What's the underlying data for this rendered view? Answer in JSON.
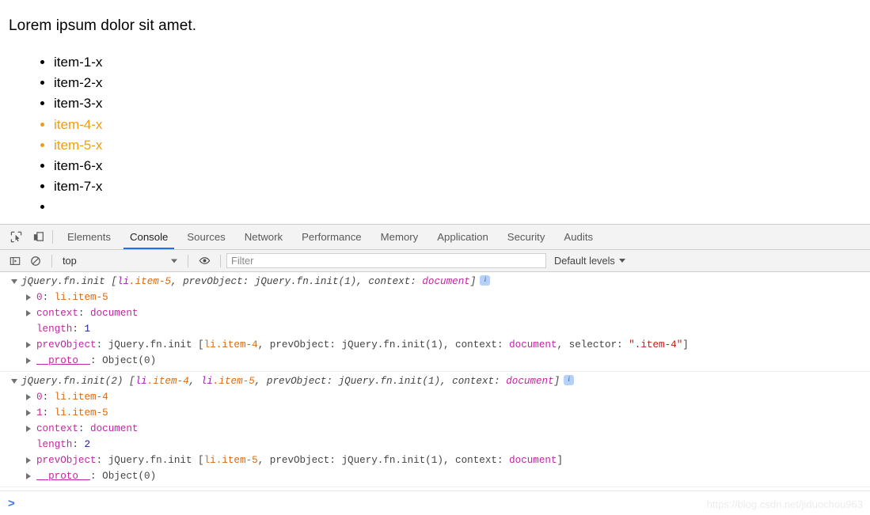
{
  "page": {
    "paragraph": "Lorem ipsum dolor sit amet.",
    "items": [
      {
        "label": "item-1-x",
        "highlighted": false
      },
      {
        "label": "item-2-x",
        "highlighted": false
      },
      {
        "label": "item-3-x",
        "highlighted": false
      },
      {
        "label": "item-4-x",
        "highlighted": true
      },
      {
        "label": "item-5-x",
        "highlighted": true
      },
      {
        "label": "item-6-x",
        "highlighted": false
      },
      {
        "label": "item-7-x",
        "highlighted": false
      },
      {
        "label": "",
        "highlighted": false
      }
    ],
    "highlight_color": "#f39c12"
  },
  "devtools": {
    "toolbar_icons": [
      {
        "name": "inspect-element-icon"
      },
      {
        "name": "device-toolbar-icon"
      }
    ],
    "tabs": [
      {
        "label": "Elements",
        "active": false
      },
      {
        "label": "Console",
        "active": true
      },
      {
        "label": "Sources",
        "active": false
      },
      {
        "label": "Network",
        "active": false
      },
      {
        "label": "Performance",
        "active": false
      },
      {
        "label": "Memory",
        "active": false
      },
      {
        "label": "Application",
        "active": false
      },
      {
        "label": "Security",
        "active": false
      },
      {
        "label": "Audits",
        "active": false
      }
    ],
    "active_tab_underline_color": "#1a73e8",
    "filterbar": {
      "sidebar_toggle_icon": "console-sidebar-icon",
      "clear_console_icon": "clear-console-icon",
      "context_value": "top",
      "eye_icon": "live-expression-icon",
      "filter_placeholder": "Filter",
      "filter_value": "",
      "levels_label": "Default levels"
    },
    "prompt_symbol": ">"
  },
  "console": {
    "messages": [
      {
        "header": [
          {
            "t": "jQuery.fn.init [",
            "c": "c-plain italic"
          },
          {
            "t": "li",
            "c": "c-tag italic"
          },
          {
            "t": ".item-5",
            "c": "c-class italic"
          },
          {
            "t": ", prevObject: jQuery.fn.init(1), context: ",
            "c": "c-plain italic"
          },
          {
            "t": "document",
            "c": "c-prop italic"
          },
          {
            "t": "]",
            "c": "c-plain italic"
          }
        ],
        "badge": "i",
        "rows": [
          {
            "expandable": true,
            "parts": [
              {
                "t": "0",
                "c": "c-prop"
              },
              {
                "t": ": ",
                "c": "c-plain"
              },
              {
                "t": "li.item-5",
                "c": "c-class"
              }
            ]
          },
          {
            "expandable": true,
            "parts": [
              {
                "t": "context",
                "c": "c-prop"
              },
              {
                "t": ": ",
                "c": "c-plain"
              },
              {
                "t": "document",
                "c": "c-prop"
              }
            ]
          },
          {
            "expandable": false,
            "parts": [
              {
                "t": "length",
                "c": "c-prop"
              },
              {
                "t": ": ",
                "c": "c-plain"
              },
              {
                "t": "1",
                "c": "c-num"
              }
            ]
          },
          {
            "expandable": true,
            "parts": [
              {
                "t": "prevObject",
                "c": "c-prop"
              },
              {
                "t": ": jQuery.fn.init [",
                "c": "c-plain"
              },
              {
                "t": "li.item-4",
                "c": "c-class"
              },
              {
                "t": ", prevObject: jQuery.fn.init(1), context: ",
                "c": "c-plain"
              },
              {
                "t": "document",
                "c": "c-prop"
              },
              {
                "t": ", selector: ",
                "c": "c-plain"
              },
              {
                "t": "\".item-4\"",
                "c": "c-str"
              },
              {
                "t": "]",
                "c": "c-plain"
              }
            ]
          },
          {
            "expandable": true,
            "parts": [
              {
                "t": "__proto__",
                "c": "c-proto"
              },
              {
                "t": ": Object(0)",
                "c": "c-plain"
              }
            ]
          }
        ]
      },
      {
        "header": [
          {
            "t": "jQuery.fn.init(2) [",
            "c": "c-plain italic"
          },
          {
            "t": "li",
            "c": "c-tag italic"
          },
          {
            "t": ".item-4",
            "c": "c-class italic"
          },
          {
            "t": ", ",
            "c": "c-plain italic"
          },
          {
            "t": "li",
            "c": "c-tag italic"
          },
          {
            "t": ".item-5",
            "c": "c-class italic"
          },
          {
            "t": ", prevObject: jQuery.fn.init(1), context: ",
            "c": "c-plain italic"
          },
          {
            "t": "document",
            "c": "c-prop italic"
          },
          {
            "t": "]",
            "c": "c-plain italic"
          }
        ],
        "badge": "i",
        "rows": [
          {
            "expandable": true,
            "parts": [
              {
                "t": "0",
                "c": "c-prop"
              },
              {
                "t": ": ",
                "c": "c-plain"
              },
              {
                "t": "li.item-4",
                "c": "c-class"
              }
            ]
          },
          {
            "expandable": true,
            "parts": [
              {
                "t": "1",
                "c": "c-prop"
              },
              {
                "t": ": ",
                "c": "c-plain"
              },
              {
                "t": "li.item-5",
                "c": "c-class"
              }
            ]
          },
          {
            "expandable": true,
            "parts": [
              {
                "t": "context",
                "c": "c-prop"
              },
              {
                "t": ": ",
                "c": "c-plain"
              },
              {
                "t": "document",
                "c": "c-prop"
              }
            ]
          },
          {
            "expandable": false,
            "parts": [
              {
                "t": "length",
                "c": "c-prop"
              },
              {
                "t": ": ",
                "c": "c-plain"
              },
              {
                "t": "2",
                "c": "c-num"
              }
            ]
          },
          {
            "expandable": true,
            "parts": [
              {
                "t": "prevObject",
                "c": "c-prop"
              },
              {
                "t": ": jQuery.fn.init [",
                "c": "c-plain"
              },
              {
                "t": "li.item-5",
                "c": "c-class"
              },
              {
                "t": ", prevObject: jQuery.fn.init(1), context: ",
                "c": "c-plain"
              },
              {
                "t": "document",
                "c": "c-prop"
              },
              {
                "t": "]",
                "c": "c-plain"
              }
            ]
          },
          {
            "expandable": true,
            "parts": [
              {
                "t": "__proto__",
                "c": "c-proto"
              },
              {
                "t": ": Object(0)",
                "c": "c-plain"
              }
            ]
          }
        ]
      }
    ]
  },
  "watermark": "https://blog.csdn.net/jiduochou963"
}
